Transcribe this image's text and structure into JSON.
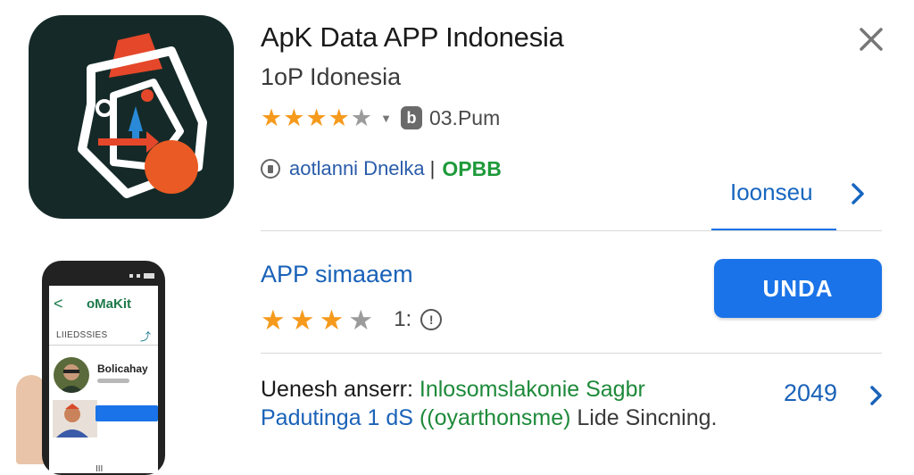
{
  "app": {
    "title": "ApK Data APP Indonesia",
    "developer": "1oP Idonesia",
    "rating_stars": {
      "filled": 4,
      "total": 5
    },
    "rating_badge": "b",
    "rating_text": "03.Pum",
    "info_text": "aotlanni Dnelka",
    "info_separator": "|",
    "info_tag": "OPBB",
    "more_link": "Ioonseu"
  },
  "rating_section": {
    "title": "APP simaaem",
    "stars": {
      "filled": 3,
      "total": 4
    },
    "count": "1:",
    "info_glyph": "!"
  },
  "install_button": {
    "label": "UNDA"
  },
  "phone": {
    "title": "oMaKit",
    "back": "<",
    "section": "LIIEDSSIES",
    "name": "Bolicahay",
    "home": "III"
  },
  "description": {
    "line1_prefix": "Uenesh anserr:",
    "line1_highlight": "Inlosomslakonie Sagbr",
    "line2_blue": "Padutinga 1 dS",
    "line2_green": "((oyarthonsme)",
    "line2_grey": "Lide Sincning."
  },
  "year_link": "2049",
  "icons": [
    "app-logo-icon",
    "close-icon",
    "star-icon",
    "caret-down-icon",
    "info-icon",
    "chevron-right-icon"
  ],
  "colors": {
    "accent": "#1a73e8",
    "star": "#f59a1d",
    "tag_green": "#1e9a3a",
    "icon_bg": "#152a28"
  }
}
